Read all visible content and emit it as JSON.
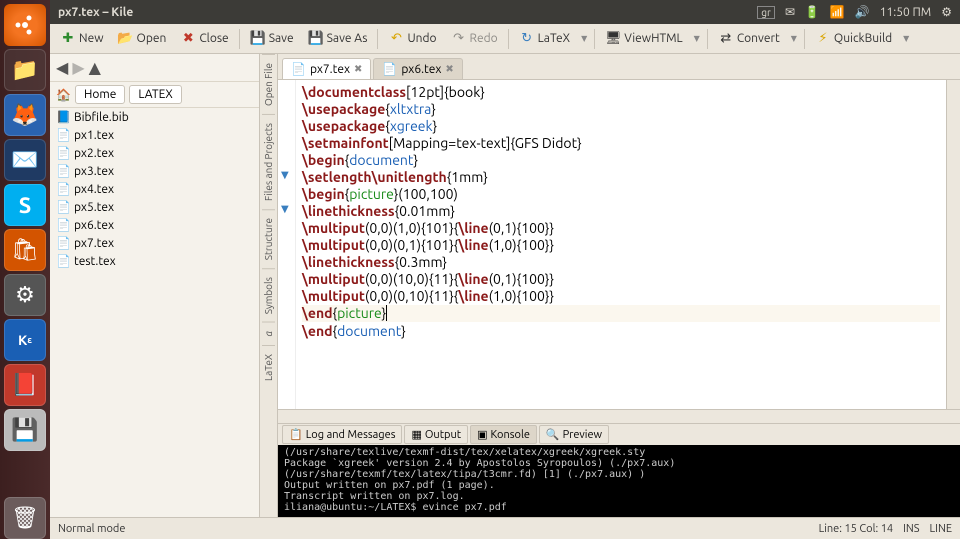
{
  "window": {
    "title": "px7.tex – Kile"
  },
  "topbar": {
    "lang": "gr",
    "time": "11:50 ΠΜ"
  },
  "toolbar": {
    "new": "New",
    "open": "Open",
    "close": "Close",
    "save": "Save",
    "saveas": "Save As",
    "undo": "Undo",
    "redo": "Redo",
    "latex": "LaTeX",
    "viewhtml": "ViewHTML",
    "convert": "Convert",
    "quickbuild": "QuickBuild"
  },
  "crumb": {
    "home": "Home",
    "folder": "LATEX"
  },
  "files": [
    "Bibfile.bib",
    "px1.tex",
    "px2.tex",
    "px3.tex",
    "px4.tex",
    "px5.tex",
    "px6.tex",
    "px7.tex",
    "test.tex"
  ],
  "vtabs": {
    "open": "Open File",
    "proj": "Files and Projects",
    "struct": "Structure",
    "sym": "Symbols",
    "latex": "LaTeX"
  },
  "tabs": [
    {
      "label": "px7.tex",
      "active": true
    },
    {
      "label": "px6.tex",
      "active": false
    }
  ],
  "code": {
    "lines": [
      [
        [
          "cmd",
          "\\documentclass"
        ],
        [
          "txt",
          "[12pt]{book}"
        ]
      ],
      [
        [
          "cmd",
          "\\usepackage"
        ],
        [
          "brace-mark",
          "{"
        ],
        [
          "env-doc",
          "xltxtra"
        ],
        [
          "brace-mark",
          "}"
        ]
      ],
      [
        [
          "cmd",
          "\\usepackage"
        ],
        [
          "brace-mark",
          "{"
        ],
        [
          "env-doc",
          "xgreek"
        ],
        [
          "brace-mark",
          "}"
        ]
      ],
      [
        [
          "cmd",
          "\\setmainfont"
        ],
        [
          "txt",
          "[Mapping=tex-text]{GFS Didot}"
        ]
      ],
      [
        [
          "txt",
          ""
        ]
      ],
      [
        [
          "cmd",
          "\\begin"
        ],
        [
          "brace-mark",
          "{"
        ],
        [
          "env-doc",
          "document"
        ],
        [
          "brace-mark",
          "}"
        ]
      ],
      [
        [
          "cmd",
          "\\setlength\\unitlength"
        ],
        [
          "txt",
          "{1mm}"
        ]
      ],
      [
        [
          "cmd",
          "\\begin"
        ],
        [
          "brace-mark",
          "{"
        ],
        [
          "env-pic",
          "picture"
        ],
        [
          "brace-mark",
          "}"
        ],
        [
          "txt",
          "(100,100)"
        ]
      ],
      [
        [
          "cmd",
          "\\linethickness"
        ],
        [
          "txt",
          "{0.01mm}"
        ]
      ],
      [
        [
          "cmd",
          "\\multiput"
        ],
        [
          "txt",
          "(0,0)(1,0){101}{"
        ],
        [
          "cmd",
          "\\line"
        ],
        [
          "txt",
          "(0,1){100}}"
        ]
      ],
      [
        [
          "cmd",
          "\\multiput"
        ],
        [
          "txt",
          "(0,0)(0,1){101}{"
        ],
        [
          "cmd",
          "\\line"
        ],
        [
          "txt",
          "(1,0){100}}"
        ]
      ],
      [
        [
          "cmd",
          "\\linethickness"
        ],
        [
          "txt",
          "{0.3mm}"
        ]
      ],
      [
        [
          "cmd",
          "\\multiput"
        ],
        [
          "txt",
          "(0,0)(10,0){11}{"
        ],
        [
          "cmd",
          "\\line"
        ],
        [
          "txt",
          "(0,1){100}}"
        ]
      ],
      [
        [
          "cmd",
          "\\multiput"
        ],
        [
          "txt",
          "(0,0)(0,10){11}{"
        ],
        [
          "cmd",
          "\\line"
        ],
        [
          "txt",
          "(1,0){100}}"
        ]
      ],
      [
        [
          "cmd",
          "\\end"
        ],
        [
          "brace-mark",
          "{"
        ],
        [
          "env-pic",
          "picture"
        ],
        [
          "brace-mark",
          "}"
        ]
      ],
      [
        [
          "cmd",
          "\\end"
        ],
        [
          "brace-mark",
          "{"
        ],
        [
          "env-doc",
          "document"
        ],
        [
          "brace-mark",
          "}"
        ]
      ]
    ],
    "hl_line": 14,
    "folds": [
      5,
      7
    ]
  },
  "btabs": {
    "log": "Log and Messages",
    "output": "Output",
    "konsole": "Konsole",
    "preview": "Preview"
  },
  "console": "(/usr/share/texlive/texmf-dist/tex/xelatex/xgreek/xgreek.sty\nPackage `xgreek' version 2.4 by Apostolos Syropoulos) (./px7.aux)\n(/usr/share/texmf/tex/latex/tipa/t3cmr.fd) [1] (./px7.aux) )\nOutput written on px7.pdf (1 page).\nTranscript written on px7.log.\niliana@ubuntu:~/LATEX$ evince px7.pdf",
  "status": {
    "mode": "Normal mode",
    "pos": "Line: 15 Col: 14",
    "ins": "INS",
    "wrap": "LINE"
  }
}
